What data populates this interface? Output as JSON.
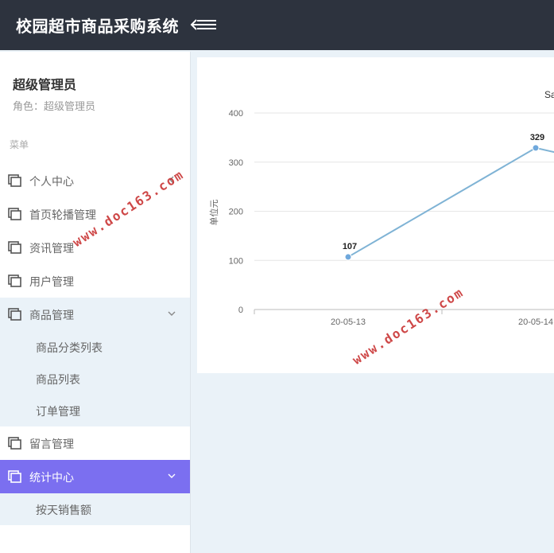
{
  "header": {
    "app_title": "校园超市商品采购系统"
  },
  "sidebar": {
    "user_name": "超级管理员",
    "user_role": "角色：超级管理员",
    "menu_caption": "菜单",
    "items": [
      {
        "label": "个人中心",
        "state": "collapsed",
        "arrow": "chevron-left"
      },
      {
        "label": "首页轮播管理",
        "state": "normal"
      },
      {
        "label": "资讯管理",
        "state": "normal"
      },
      {
        "label": "用户管理",
        "state": "normal"
      },
      {
        "label": "商品管理",
        "state": "expanded",
        "arrow": "chevron-down"
      },
      {
        "label": "留言管理",
        "state": "normal"
      },
      {
        "label": "统计中心",
        "state": "active",
        "arrow": "chevron-down"
      }
    ],
    "goods_sub_items": [
      "商品分类列表",
      "商品列表",
      "订单管理"
    ],
    "stats_sub_items": [
      "按天销售额"
    ]
  },
  "watermark": "www.doc163.com",
  "colors": {
    "topbar": "#2d333e",
    "active_menu": "#7b6ff0",
    "line": "#7fb3d5",
    "point": "#6fa8dc"
  },
  "chart_data": {
    "type": "line",
    "title_fragment": "Sa",
    "ylabel": "单位元",
    "ylim": [
      0,
      400
    ],
    "yticks": [
      "0",
      "100",
      "200",
      "300",
      "400"
    ],
    "categories": [
      "20-05-13",
      "20-05-14"
    ],
    "values": [
      107,
      329
    ],
    "data_labels": [
      "107",
      "329"
    ],
    "grid": true
  }
}
